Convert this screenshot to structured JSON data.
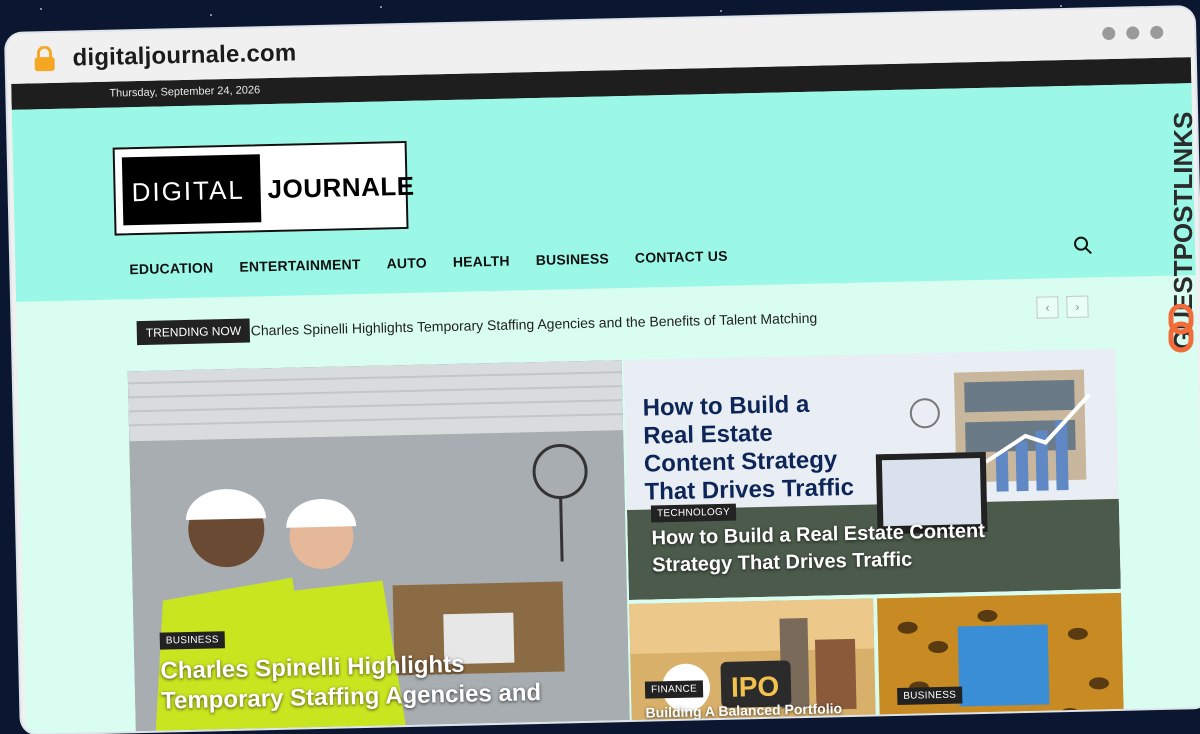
{
  "browser": {
    "url": "digitaljournale.com"
  },
  "topbar": {
    "date": "Thursday, September 24, 2026"
  },
  "logo": {
    "word1": "DIGITAL",
    "word2": "JOURNALE"
  },
  "nav": {
    "items": [
      "EDUCATION",
      "ENTERTAINMENT",
      "AUTO",
      "HEALTH",
      "BUSINESS",
      "CONTACT US"
    ]
  },
  "icons": {
    "lock": "lock-icon",
    "search": "search-icon",
    "prev": "chevron-left-icon",
    "next": "chevron-right-icon"
  },
  "trending": {
    "label": "TRENDING NOW",
    "headline": "Charles Spinelli Highlights Temporary Staffing Agencies and the Benefits of Talent Matching"
  },
  "cards": [
    {
      "category": "BUSINESS",
      "title": "Charles Spinelli Highlights Temporary Staffing Agencies and"
    },
    {
      "category": "TECHNOLOGY",
      "title": "How to Build a Real Estate Content Strategy That Drives Traffic",
      "image_text": "How to Build a Real Estate Content Strategy That Drives Traffic"
    },
    {
      "category": "FINANCE",
      "title": "Building A Balanced Portfolio",
      "image_text": "IPO"
    },
    {
      "category": "BUSINESS",
      "title": ""
    }
  ],
  "watermark": {
    "text": "GUESTPOSTLINKS"
  },
  "colors": {
    "header_bg": "#9cf8e6",
    "page_bg": "#d9fdf1",
    "topbar_bg": "#1e1e1e",
    "badge_bg": "#222222",
    "brand_orange": "#f26b3a"
  }
}
